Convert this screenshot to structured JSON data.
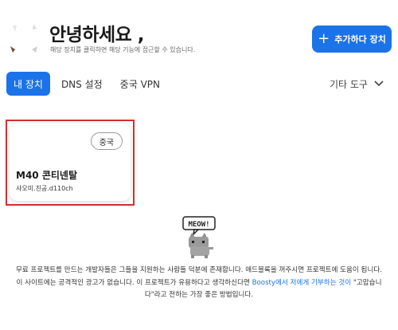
{
  "header": {
    "greeting": "안녕하세요 ,",
    "subtitle": "해당 장치를 클릭하면 해당 기능에 접근할 수 있습니다.",
    "add_button": "추가하다 장치"
  },
  "tabs": [
    {
      "label": "내 장치",
      "active": true
    },
    {
      "label": "DNS 설정",
      "active": false
    },
    {
      "label": "중국 VPN",
      "active": false
    }
  ],
  "tools": {
    "label": "기타 도구"
  },
  "devices": [
    {
      "region_badge": "중국",
      "name": "M40 콘티넨탈",
      "id": "샤오미.친공.d110ch"
    }
  ],
  "mascot": {
    "speech": "MEOW!"
  },
  "donation": {
    "text_before": "무료 프로젝트를 만드는 개발자들은 그들을 지원하는 사람들 덕분에 존재합니다. 애드블록을 꺼주시면 프로젝트에 도움이 됩니다. 이 사이트에는 공격적인 광고가 없습니다. 이 프로젝트가 유용하다고 생각하신다면 ",
    "link_text": "Boosty에서 저에게 기부하는 것이",
    "text_after": " \"고맙습니다\"라고 전하는 가장 좋은 방법입니다."
  },
  "colors": {
    "accent": "#1a73e8",
    "highlight": "#d32f2f"
  }
}
